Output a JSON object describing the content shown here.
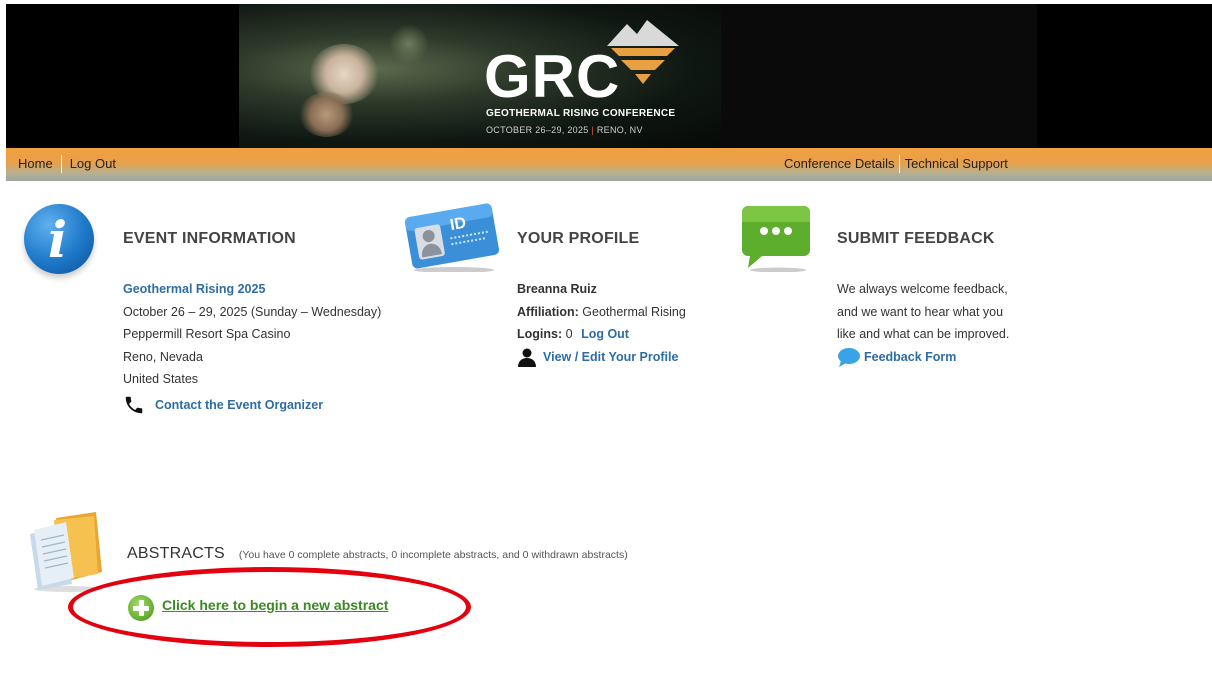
{
  "banner": {
    "logo_text": "GRC",
    "logo_subtitle": "GEOTHERMAL RISING CONFERENCE",
    "logo_date": "OCTOBER 26–29, 2025",
    "logo_date_sep": "|",
    "logo_location": "RENO, NV"
  },
  "nav": {
    "left": [
      "Home",
      "Log Out"
    ],
    "right": [
      "Conference Details",
      "Technical Support"
    ]
  },
  "event": {
    "heading": "EVENT INFORMATION",
    "name": "Geothermal Rising 2025",
    "dates": "October 26 – 29, 2025 (Sunday – Wednesday)",
    "venue": "Peppermill Resort Spa Casino",
    "city": "Reno, Nevada",
    "country": "United States",
    "contact_link": "Contact the Event Organizer"
  },
  "profile": {
    "heading": "YOUR PROFILE",
    "name": "Breanna Ruiz",
    "affiliation_label": "Affiliation:",
    "affiliation_value": "Geothermal Rising",
    "logins_label": "Logins:",
    "logins_value": "0",
    "logout_link": "Log Out",
    "edit_link": "View / Edit Your Profile",
    "id_badge_text": "ID"
  },
  "feedback": {
    "heading": "SUBMIT FEEDBACK",
    "line1": "We always welcome feedback,",
    "line2": "and we want to hear what you",
    "line3": "like and what can be improved.",
    "form_link": "Feedback Form"
  },
  "abstracts": {
    "heading": "ABSTRACTS",
    "summary": "(You have 0 complete abstracts, 0 incomplete abstracts, and 0 withdrawn abstracts)",
    "new_link": "Click here to begin a new abstract"
  },
  "colors": {
    "nav_orange": "#f0a040",
    "link_blue": "#2e6da4",
    "link_green": "#3b8a22",
    "highlight_red": "#e3000f"
  }
}
